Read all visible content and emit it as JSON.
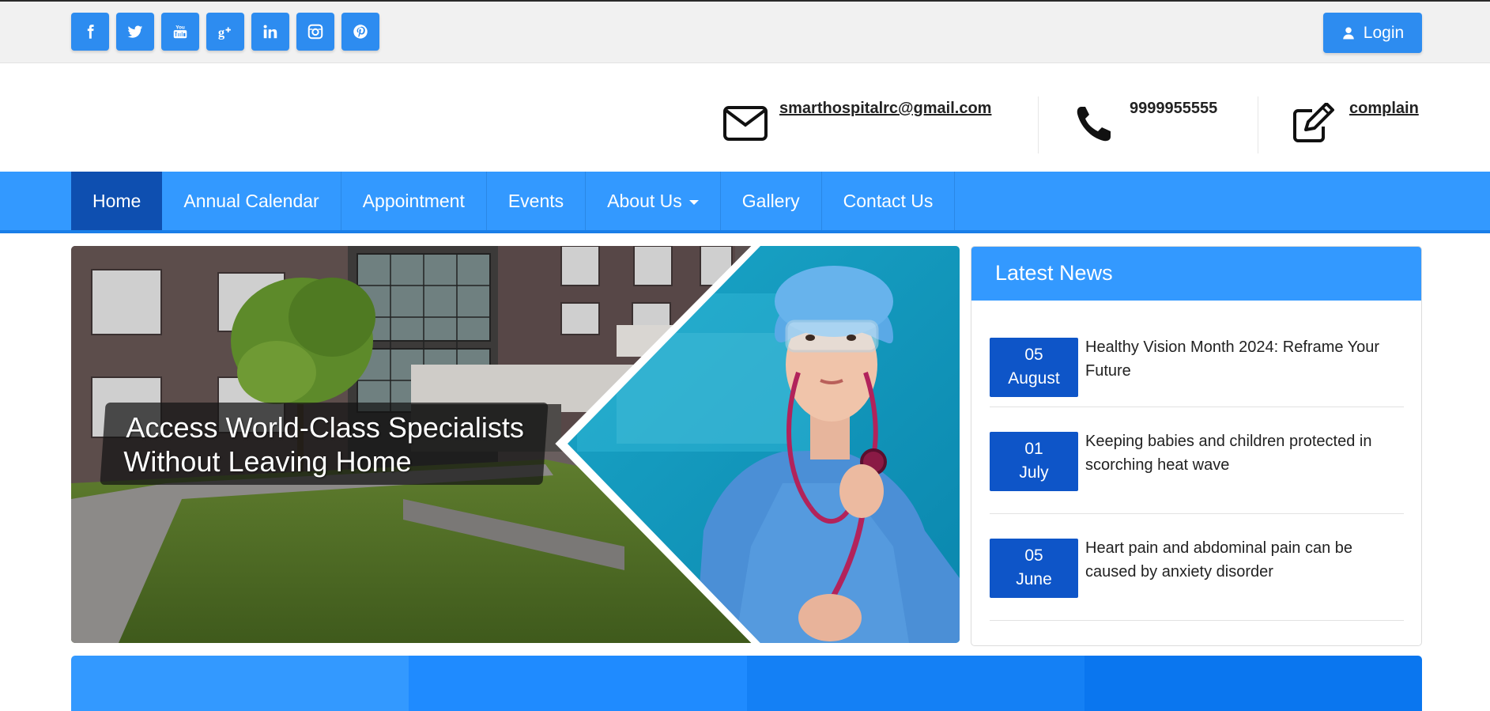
{
  "socials": [
    {
      "name": "facebook-icon"
    },
    {
      "name": "twitter-icon"
    },
    {
      "name": "youtube-icon"
    },
    {
      "name": "google-plus-icon"
    },
    {
      "name": "linkedin-icon"
    },
    {
      "name": "instagram-icon"
    },
    {
      "name": "pinterest-icon"
    }
  ],
  "login": {
    "label": "Login"
  },
  "contact": {
    "email": "smarthospitalrc@gmail.com",
    "phone": "9999955555",
    "complain": "complain"
  },
  "nav": {
    "items": [
      {
        "label": "Home"
      },
      {
        "label": "Annual Calendar"
      },
      {
        "label": "Appointment"
      },
      {
        "label": "Events"
      },
      {
        "label": "About Us"
      },
      {
        "label": "Gallery"
      },
      {
        "label": "Contact Us"
      }
    ]
  },
  "hero": {
    "caption_line1": "Access World-Class Specialists",
    "caption_line2": "Without Leaving Home"
  },
  "news": {
    "heading": "Latest News",
    "items": [
      {
        "day": "05",
        "month": "August",
        "title": "Healthy Vision Month 2024: Reframe Your Future"
      },
      {
        "day": "01",
        "month": "July",
        "title": "Keeping babies and children protected in scorching heat wave"
      },
      {
        "day": "05",
        "month": "June",
        "title": "Heart pain and abdominal pain can be caused by anxiety disorder"
      }
    ]
  },
  "colors": {
    "primary": "#3399ff",
    "dark": "#0e4fb0",
    "date_bg": "#0e55c8",
    "social_bg": "#2d8cf0"
  }
}
